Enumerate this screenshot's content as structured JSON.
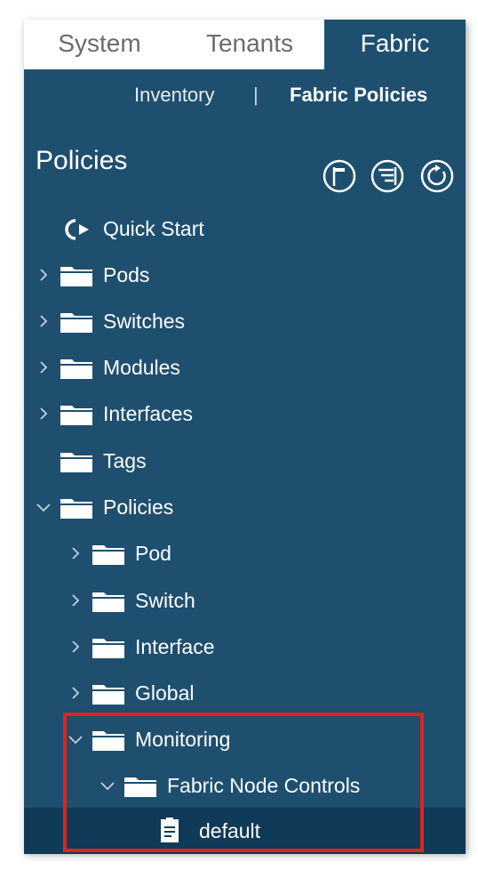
{
  "tabs": [
    "System",
    "Tenants",
    "Fabric"
  ],
  "active_tab": "Fabric",
  "subnav": {
    "inventory": "Inventory",
    "separator": "|",
    "fabric_policies": "Fabric Policies"
  },
  "panel": {
    "title": "Policies"
  },
  "tree": {
    "quick_start": "Quick Start",
    "pods": "Pods",
    "switches": "Switches",
    "modules": "Modules",
    "interfaces": "Interfaces",
    "tags": "Tags",
    "policies": "Policies",
    "pod": "Pod",
    "switch": "Switch",
    "interface": "Interface",
    "global": "Global",
    "monitoring": "Monitoring",
    "fabric_node_controls": "Fabric Node Controls",
    "default": "default"
  },
  "colors": {
    "panel": "#1e4f6f",
    "selected_row": "#0f3a58",
    "highlight_box": "#e2231a"
  },
  "icons": [
    "folder-icon",
    "chevron-right-icon",
    "chevron-down-icon",
    "quick-start-icon",
    "document-icon",
    "flag-icon",
    "list-icon",
    "refresh-icon"
  ]
}
